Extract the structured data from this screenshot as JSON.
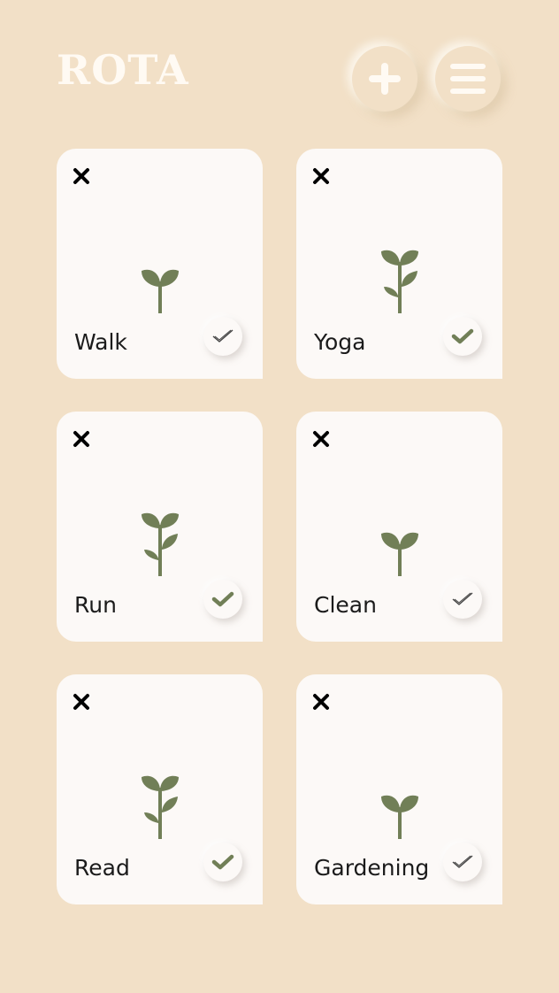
{
  "header": {
    "title": "ROTA",
    "add_icon": "plus-icon",
    "menu_icon": "hamburger-menu-icon"
  },
  "colors": {
    "background": "#f2e0c7",
    "card": "#fcf9f7",
    "plant": "#717f57",
    "title": "#fffaf3"
  },
  "activities": [
    {
      "name": "Walk",
      "plant_stage": "seedling",
      "completed": false
    },
    {
      "name": "Yoga",
      "plant_stage": "sapling",
      "completed": true
    },
    {
      "name": "Run",
      "plant_stage": "sapling",
      "completed": true
    },
    {
      "name": "Clean",
      "plant_stage": "seedling",
      "completed": false
    },
    {
      "name": "Read",
      "plant_stage": "sapling",
      "completed": true
    },
    {
      "name": "Gardening",
      "plant_stage": "seedling",
      "completed": false
    }
  ]
}
